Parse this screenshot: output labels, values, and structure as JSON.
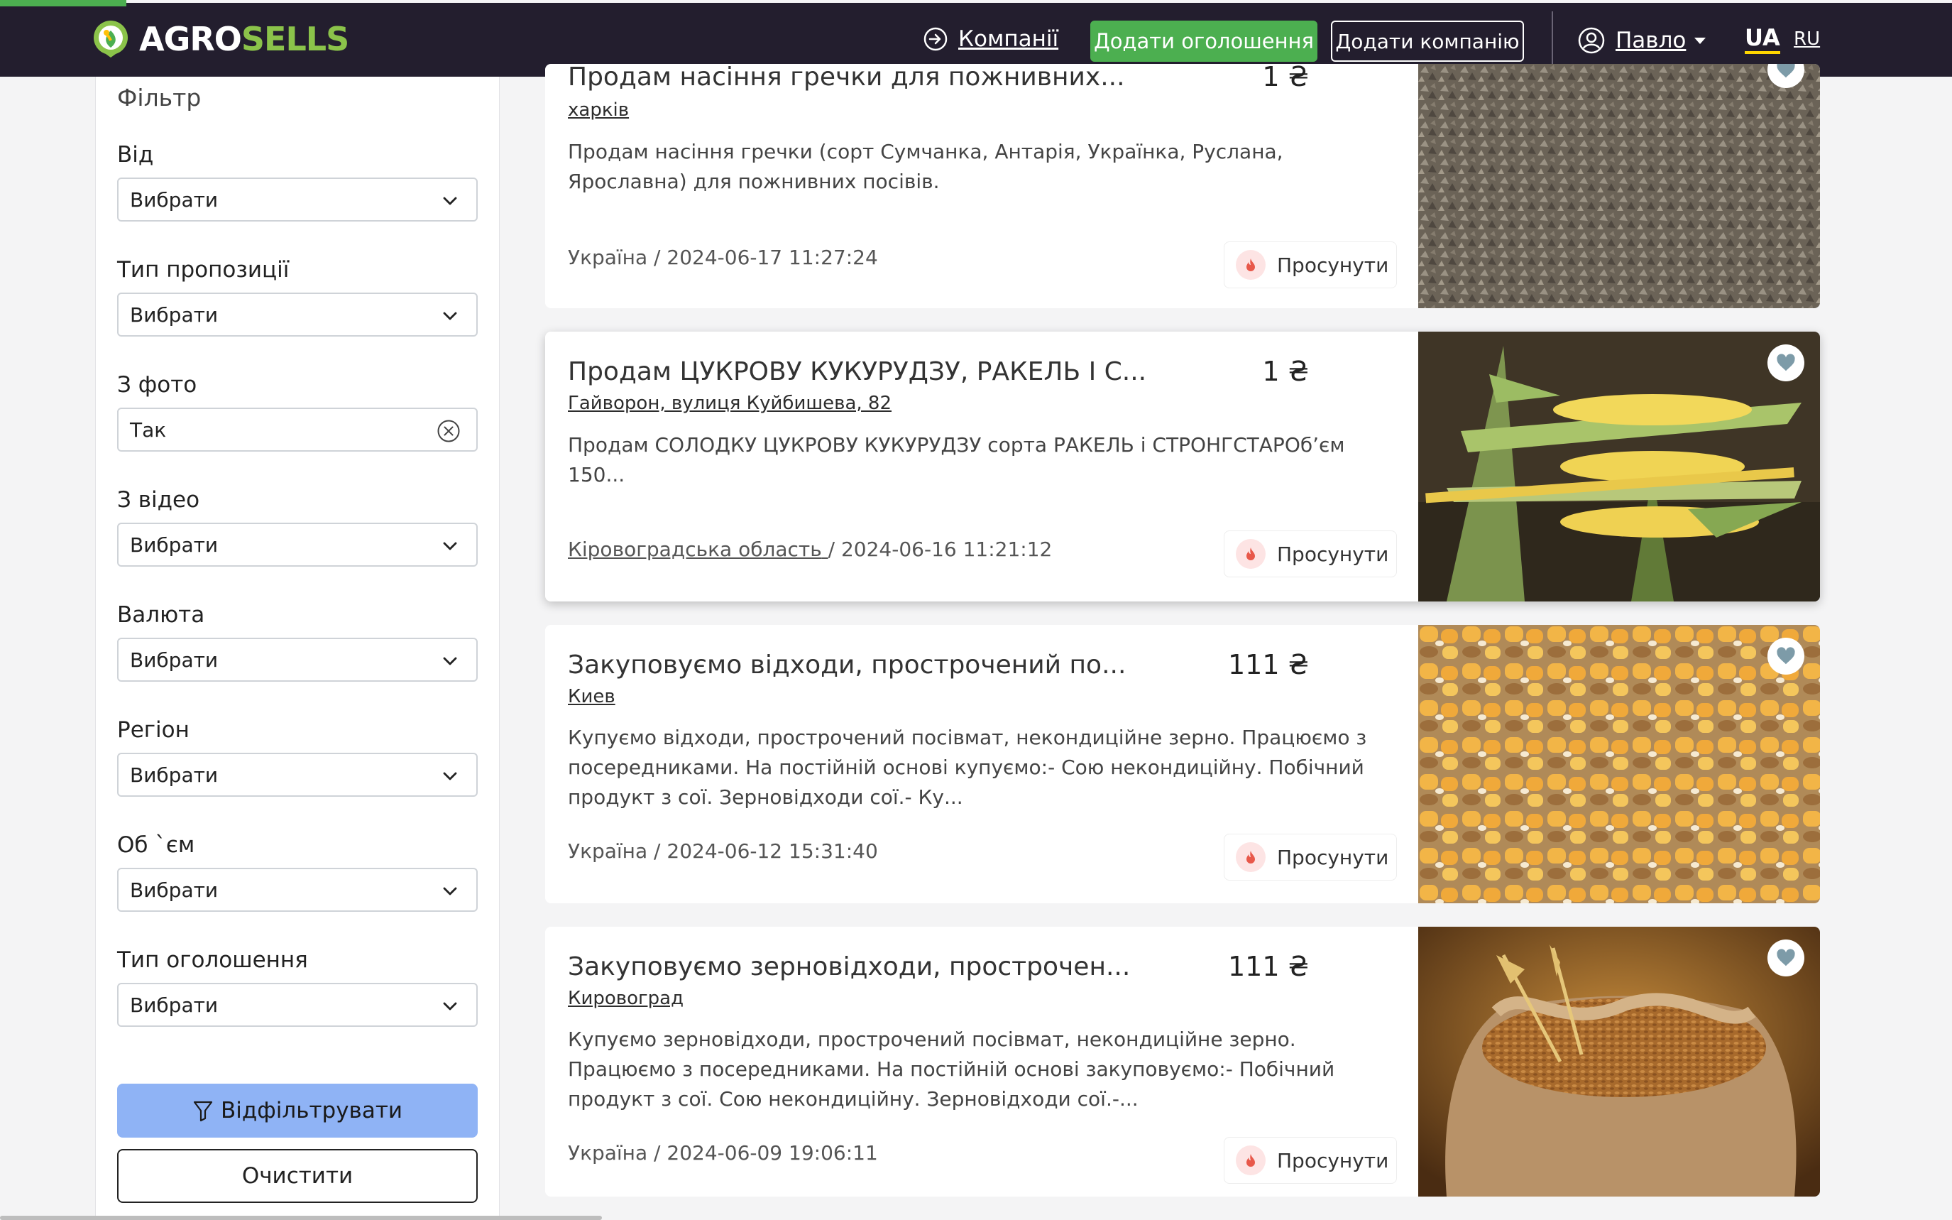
{
  "header": {
    "logo_part1": "AGRO",
    "logo_part2": "SELLS",
    "companies_link": "Компанії",
    "add_listing_button": "Додати оголошення",
    "add_company_button": "Додати компанію",
    "user_name": "Павло",
    "lang_ua": "UA",
    "lang_ru": "RU"
  },
  "filter": {
    "title": "Фільтр",
    "fields": [
      {
        "label": "Від",
        "value": "Вибрати"
      },
      {
        "label": "Тип пропозиції",
        "value": "Вибрати"
      },
      {
        "label": "З фото",
        "value": "Так"
      },
      {
        "label": "З відео",
        "value": "Вибрати"
      },
      {
        "label": "Валюта",
        "value": "Вибрати"
      },
      {
        "label": "Регіон",
        "value": "Вибрати"
      },
      {
        "label": "Об `єм",
        "value": "Вибрати"
      },
      {
        "label": "Тип оголошення",
        "value": "Вибрати"
      }
    ],
    "filter_button": "Відфільтрувати",
    "clear_button": "Очистити"
  },
  "listings": [
    {
      "title": "Продам насіння гречки для пожнивних...",
      "price": "1 ₴",
      "location": "харків",
      "description": "Продам насіння гречки (сорт Сумчанка, Антарія, Українка, Руслана, Ярославна) для пожнивних посівів.",
      "region": "Україна",
      "date": "2024-06-17 11:27:24",
      "promote": "Просунути",
      "image": "buckwheat-photo"
    },
    {
      "title": "Продам ЦУКРОВУ КУКУРУДЗУ, РАКЕЛЬ І С...",
      "price": "1 ₴",
      "location": "Гайворон, вулиця Куйбишева, 82",
      "description": "Продам СОЛОДКУ ЦУКРОВУ КУКУРУДЗУ сорта РАКЕЛЬ і СТРОНГСТАРОб’єм 150...",
      "region": "Кіровоградська область",
      "date": "2024-06-16 11:21:12",
      "promote": "Просунути",
      "image": "corn-cobs-photo"
    },
    {
      "title": "Закуповуємо відходи, прострочений по...",
      "price": "111 ₴",
      "location": "Киев",
      "description": "Купуємо відходи, прострочений посівмат, некондиційне зерно. Працюємо з посередниками. На постійній основі купуємо:- Сою некондиційну. Побічний продукт з сої. Зерновідходи сої.- Ку...",
      "region": "Україна",
      "date": "2024-06-12 15:31:40",
      "promote": "Просунути",
      "image": "corn-wheat-grains-photo"
    },
    {
      "title": "Закуповуємо зерновідходи, прострочен...",
      "price": "111 ₴",
      "location": "Кировоград",
      "description": "Купуємо зерновідходи, прострочений посівмат, некондиційне зерно. Працюємо з посередниками. На постійній основі закуповуємо:- Побічний продукт з сої. Сою некондиційну. Зерновідходи сої.-...",
      "region": "Україна",
      "date": "2024-06-09 19:06:11",
      "promote": "Просунути",
      "image": "grain-sack-photo"
    }
  ],
  "colors": {
    "header_bg": "#231e2e",
    "brand_green": "#4caf50",
    "logo_green": "#8bc34a",
    "filter_button": "#8fb3f5",
    "lang_underline": "#ffd600"
  }
}
